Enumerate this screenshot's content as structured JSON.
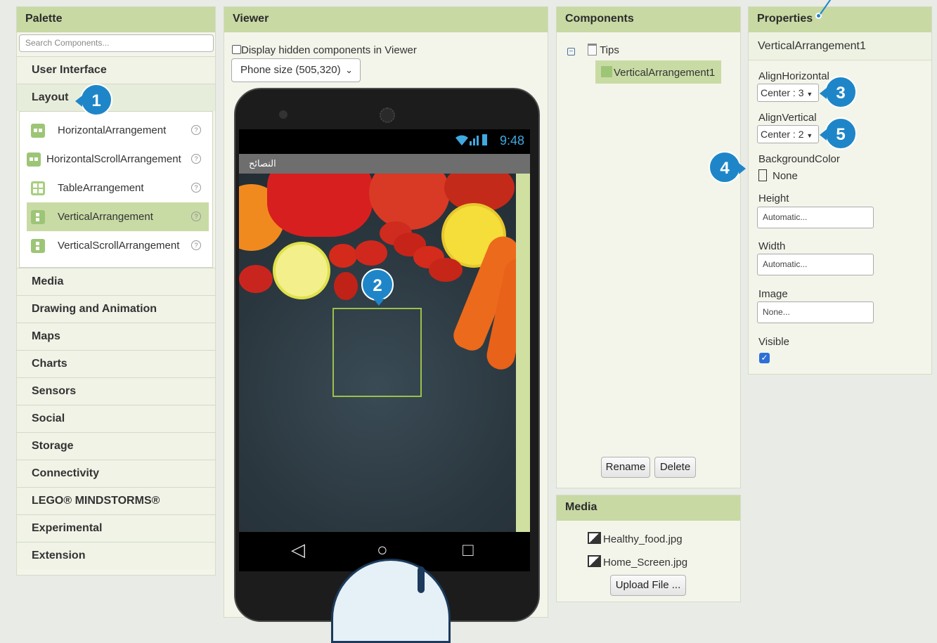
{
  "palette": {
    "header": "Palette",
    "search_placeholder": "Search Components...",
    "categories_top": [
      "User Interface",
      "Layout"
    ],
    "layout_items": [
      {
        "label": "HorizontalArrangement",
        "icon": "horizontal-arrangement-icon"
      },
      {
        "label": "HorizontalScrollArrangement",
        "icon": "horizontal-scroll-arrangement-icon"
      },
      {
        "label": "TableArrangement",
        "icon": "table-arrangement-icon"
      },
      {
        "label": "VerticalArrangement",
        "icon": "vertical-arrangement-icon",
        "selected": true
      },
      {
        "label": "VerticalScrollArrangement",
        "icon": "vertical-scroll-arrangement-icon"
      }
    ],
    "help_glyph": "?",
    "categories_bottom": [
      "Media",
      "Drawing and Animation",
      "Maps",
      "Charts",
      "Sensors",
      "Social",
      "Storage",
      "Connectivity",
      "LEGO® MINDSTORMS®",
      "Experimental",
      "Extension"
    ]
  },
  "viewer": {
    "header": "Viewer",
    "display_hidden_label": "Display hidden components in Viewer",
    "phone_size": "Phone size (505,320)",
    "status_time": "9:48",
    "app_title": "النصائح",
    "nav": {
      "back": "◁",
      "home": "○",
      "recent": "□"
    }
  },
  "components": {
    "header": "Components",
    "root": "Tips",
    "child": "VerticalArrangement1",
    "rename_label": "Rename",
    "delete_label": "Delete"
  },
  "media": {
    "header": "Media",
    "files": [
      "Healthy_food.jpg",
      "Home_Screen.jpg"
    ],
    "upload_label": "Upload File ..."
  },
  "properties": {
    "header": "Properties",
    "component": "VerticalArrangement1",
    "align_horizontal": {
      "label": "AlignHorizontal",
      "value": "Center : 3"
    },
    "align_vertical": {
      "label": "AlignVertical",
      "value": "Center : 2"
    },
    "background_color": {
      "label": "BackgroundColor",
      "value": "None"
    },
    "height": {
      "label": "Height",
      "value": "Automatic..."
    },
    "width": {
      "label": "Width",
      "value": "Automatic..."
    },
    "image": {
      "label": "Image",
      "value": "None..."
    },
    "visible": {
      "label": "Visible",
      "checked": true
    }
  },
  "callouts": [
    "1",
    "2",
    "3",
    "4",
    "5"
  ],
  "colors": {
    "header": "#c8d9a4",
    "selected": "#c9dba5",
    "callout": "#1e86c8",
    "accent_status": "#3fa9e0"
  }
}
